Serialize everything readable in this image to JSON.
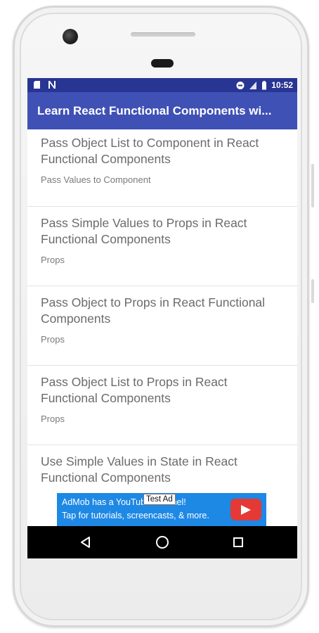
{
  "status_bar": {
    "time": "10:52",
    "icons_left": [
      "sd-card-icon",
      "n-notification-icon"
    ],
    "icons_right": [
      "do-not-disturb-icon",
      "signal-icon",
      "battery-icon"
    ]
  },
  "app_bar": {
    "title": "Learn React Functional Components wi..."
  },
  "list": {
    "items": [
      {
        "title": "Pass Object List to Component in React Functional Components",
        "subtitle": "Pass Values to Component"
      },
      {
        "title": "Pass Simple Values to Props in React Functional Components",
        "subtitle": "Props"
      },
      {
        "title": "Pass Object to Props in React Functional Components",
        "subtitle": "Props"
      },
      {
        "title": "Pass Object List to Props in React Functional Components",
        "subtitle": "Props"
      },
      {
        "title": "Use Simple Values in State in React Functional Components",
        "subtitle": ""
      }
    ]
  },
  "ad": {
    "line1": "AdMob has a YouTube channel!",
    "line2": "Tap for tutorials, screencasts, & more.",
    "tag": "Test Ad",
    "button_icon": "play-icon"
  },
  "nav_bar": {
    "back_icon": "back-triangle-icon",
    "home_icon": "home-circle-icon",
    "recents_icon": "recents-square-icon"
  },
  "colors": {
    "status_bar": "#283593",
    "app_bar": "#3f51b5",
    "ad_background": "#1e88e5",
    "ad_button": "#e53935",
    "nav_bar": "#000000"
  }
}
